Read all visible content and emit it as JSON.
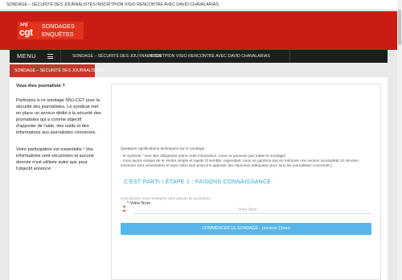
{
  "topbar": {
    "links": [
      "SONDAGE – SÉCURITÉ DES JOURNALISTES",
      "INSCRITPION VISIO RENCONTRE AVEC DAVID CHAVALARIAS"
    ]
  },
  "logo": {
    "snj": "snj",
    "cgt": "cgt",
    "line1": "SONDAGES",
    "line2": "ENQUÊTES"
  },
  "nav": {
    "menu_label": "MENU",
    "items": [
      "SONDAGE – SÉCURITÉ DES JOURNALISTES",
      "INSCRITPION VISIO RENCONTRE AVEC DAVID CHAVALARIAS"
    ]
  },
  "active_tab": "SONDAGE – SÉCURITÉ DES JOURNALISTES",
  "sidebar": {
    "heading": "Vous êtes journaliste ?",
    "paragraph1": [
      "Participez à ce sondage SNJ-CGT pour la",
      "sécurité des journalistes. Le syndicat met",
      "en place un service dédié à la sécurité des",
      "journalistes qui a comme objectif",
      "d'apporter de l'aide, des outils et des",
      "informations aux journalistes concernés."
    ],
    "paragraph2": [
      "Votre participation est essentielle ! Vos",
      "informations sont sécurisées et aucune",
      "donnée n'est utilisée autre que pour",
      "l'objectif annoncé"
    ]
  },
  "form": {
    "intro_title": "Quelques significations techniques sur le sondage :",
    "intro_lines": [
      "- le symbole * veut dire obligatoire (sans cette information, nous ne pouvons pas traiter le sondage)",
      "- nous avons essayé de le rendre simple et rapide (il semble, cependant, nous ne gardons pas en mémoire une version incomplète 10 minutes",
      "minimum sont nécessaires et avec cela nous pourrons apporter des réponses adéquates pour tous les journalistes concernés )"
    ],
    "step_title": "C'EST PARTI ! ÉTAPE 1 : FAISONS CONNAISSANCE",
    "name_hint": "(vous pouvez nous renseigner votre pseudo de journaliste)",
    "name_label": "* Votre Nom",
    "name_placeholder": "Votre Nom",
    "start_button": "COMMENCER LE SONDAGE - (environ 10mn)"
  },
  "colors": {
    "header_red": "#c91d14",
    "tab_red": "#c0392b",
    "nav_dark": "#1e1e1e",
    "accent_blue": "#2ba5d8",
    "button_blue": "#57b6ea"
  }
}
